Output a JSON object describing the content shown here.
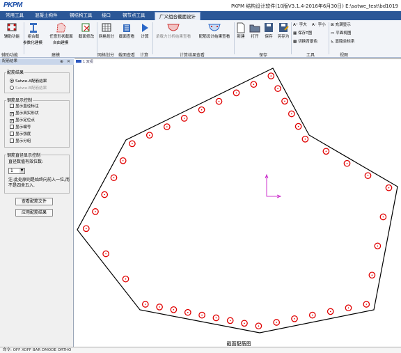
{
  "app": {
    "logo_main": "PKPM",
    "title": "PKPM 结构设计软件(10版V3.1.4-2016年6月30日) E:\\satwe_test\\bd1019"
  },
  "tabs": [
    {
      "label": "常用工具"
    },
    {
      "label": "混凝土构件"
    },
    {
      "label": "钢结构工具"
    },
    {
      "label": "接口"
    },
    {
      "label": "钢节点工具"
    },
    {
      "label": "广义组合截面设计"
    }
  ],
  "ribbon": {
    "groups": {
      "aux": "辅助功能",
      "modeling": "建模",
      "mesh": "网格划分",
      "section_view": "截面查看",
      "calc": "计算",
      "results": "计算结果查看",
      "save": "保存",
      "tools": "工具",
      "view": "视图"
    },
    "buttons": {
      "aux_rebar": "辅助功能",
      "param_model": [
        "组合截",
        "参数化建模"
      ],
      "free_model": [
        "任意形状截面",
        "自由建模"
      ],
      "modify": "截面修改",
      "mesh": "网格划分",
      "section_view": "截面查看",
      "calc": "计算",
      "force_ratio": "承载力分析结果查看",
      "rebar_result": "配筋设计结果查看",
      "new": "新建",
      "open": "打开",
      "save": "保存",
      "save_as": "另存为"
    },
    "tool_items": [
      "字大",
      "字小",
      "保存T图",
      "切换背景色"
    ],
    "view_items": [
      "充满显示",
      "平面视图",
      "显隐坐标系"
    ]
  },
  "panel": {
    "title": "配筋结果",
    "result_group": "配筋结果",
    "result_options": [
      {
        "label": "Satwe-A配筋结果",
        "selected": true,
        "enabled": true
      },
      {
        "label": "Satwe-B配筋结果",
        "selected": false,
        "enabled": false
      }
    ],
    "display_group": "钢筋显示控制",
    "display_options": [
      {
        "label": "显示直径标注",
        "checked": false
      },
      {
        "label": "显示真实形状",
        "checked": true
      },
      {
        "label": "显示定位点",
        "checked": true
      },
      {
        "label": "显示编号",
        "checked": false
      },
      {
        "label": "显示强度",
        "checked": false
      },
      {
        "label": "显示分组",
        "checked": false
      }
    ],
    "diam_group": "钢筋直径显示控制",
    "digits_label": "直径数值有效位数:",
    "digits_value": "1",
    "note": "注:此处原则是始终向前入一位,而不是四舍五入.",
    "btn_view_file": "查看配筋文件",
    "btn_apply": "应用配筋结果"
  },
  "canvas": {
    "tab_label": "1 双视",
    "caption": "截面配筋图",
    "outline_color": "#000000",
    "rebar_color": "#e00000",
    "axis_color": "#c000c0"
  },
  "cmdline": {
    "text": "命令: OFF  XOFF  BAR  DMODE  ORTHO"
  }
}
